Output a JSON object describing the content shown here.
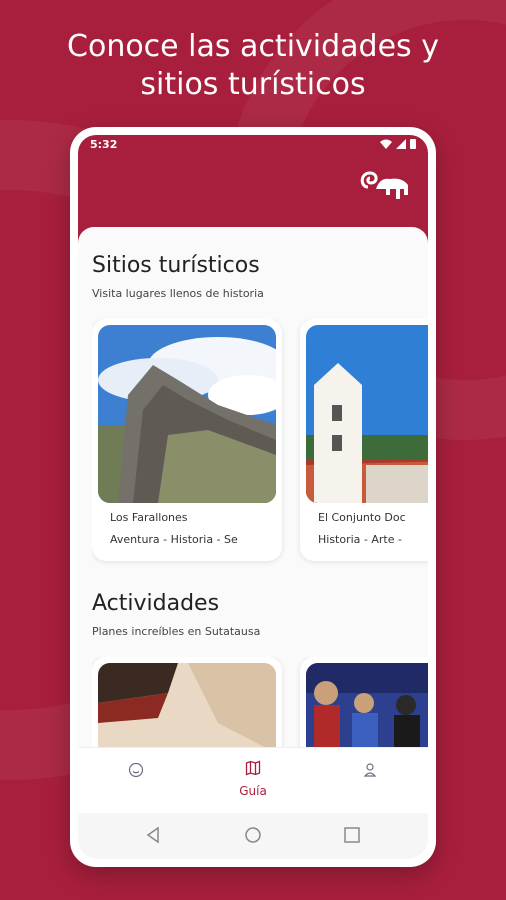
{
  "headline": {
    "line1": "Conoce las actividades y",
    "line2": "sitios turísticos"
  },
  "status_bar": {
    "time": "5:32"
  },
  "app": {
    "brand_color": "#a81f3d"
  },
  "sites_section": {
    "title": "Sitios turísticos",
    "subtitle": "Visita lugares llenos de historia",
    "cards": [
      {
        "name": "Los Farallones",
        "tags": "Aventura - Historia - Se"
      },
      {
        "name": "El Conjunto Doc",
        "tags": "Historia - Arte -"
      }
    ]
  },
  "activities_section": {
    "title": "Actividades",
    "subtitle": "Planes increíbles en Sutatausa"
  },
  "bottom_nav": {
    "items": [
      {
        "icon": "smiley-icon",
        "label": ""
      },
      {
        "icon": "map-icon",
        "label": "Guía"
      },
      {
        "icon": "user-icon",
        "label": ""
      }
    ]
  },
  "system_nav": {
    "icons": [
      "back-icon",
      "home-icon",
      "recents-icon"
    ]
  }
}
